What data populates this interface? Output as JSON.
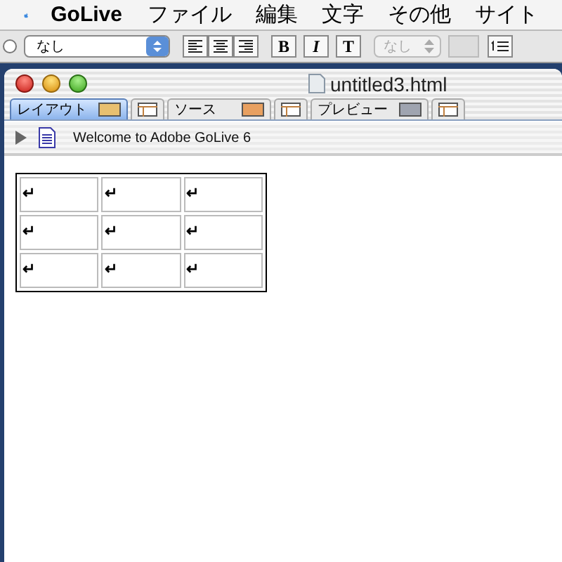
{
  "menu_bar": {
    "app_name": "GoLive",
    "items": [
      "ファイル",
      "編集",
      "文字",
      "その他",
      "サイト"
    ]
  },
  "toolbar": {
    "style_select": "なし",
    "bold": "B",
    "italic": "I",
    "teletype": "T",
    "size_select": {
      "value": "なし",
      "disabled": true
    }
  },
  "window": {
    "title": "untitled3.html"
  },
  "tabs": [
    {
      "kind": "text",
      "label": "レイアウト",
      "selected": true
    },
    {
      "kind": "icon",
      "selected": false
    },
    {
      "kind": "text",
      "label": "ソース",
      "selected": false
    },
    {
      "kind": "icon",
      "selected": false
    },
    {
      "kind": "text",
      "label": "プレビュー",
      "selected": false
    },
    {
      "kind": "icon",
      "selected": false
    }
  ],
  "breadcrumb": {
    "expanded": false,
    "text": "Welcome to Adobe GoLive 6"
  },
  "table": {
    "rows": [
      [
        "↵",
        "↵",
        "↵"
      ],
      [
        "↵",
        "↵",
        "↵"
      ],
      [
        "↵",
        "↵",
        "↵"
      ]
    ]
  }
}
